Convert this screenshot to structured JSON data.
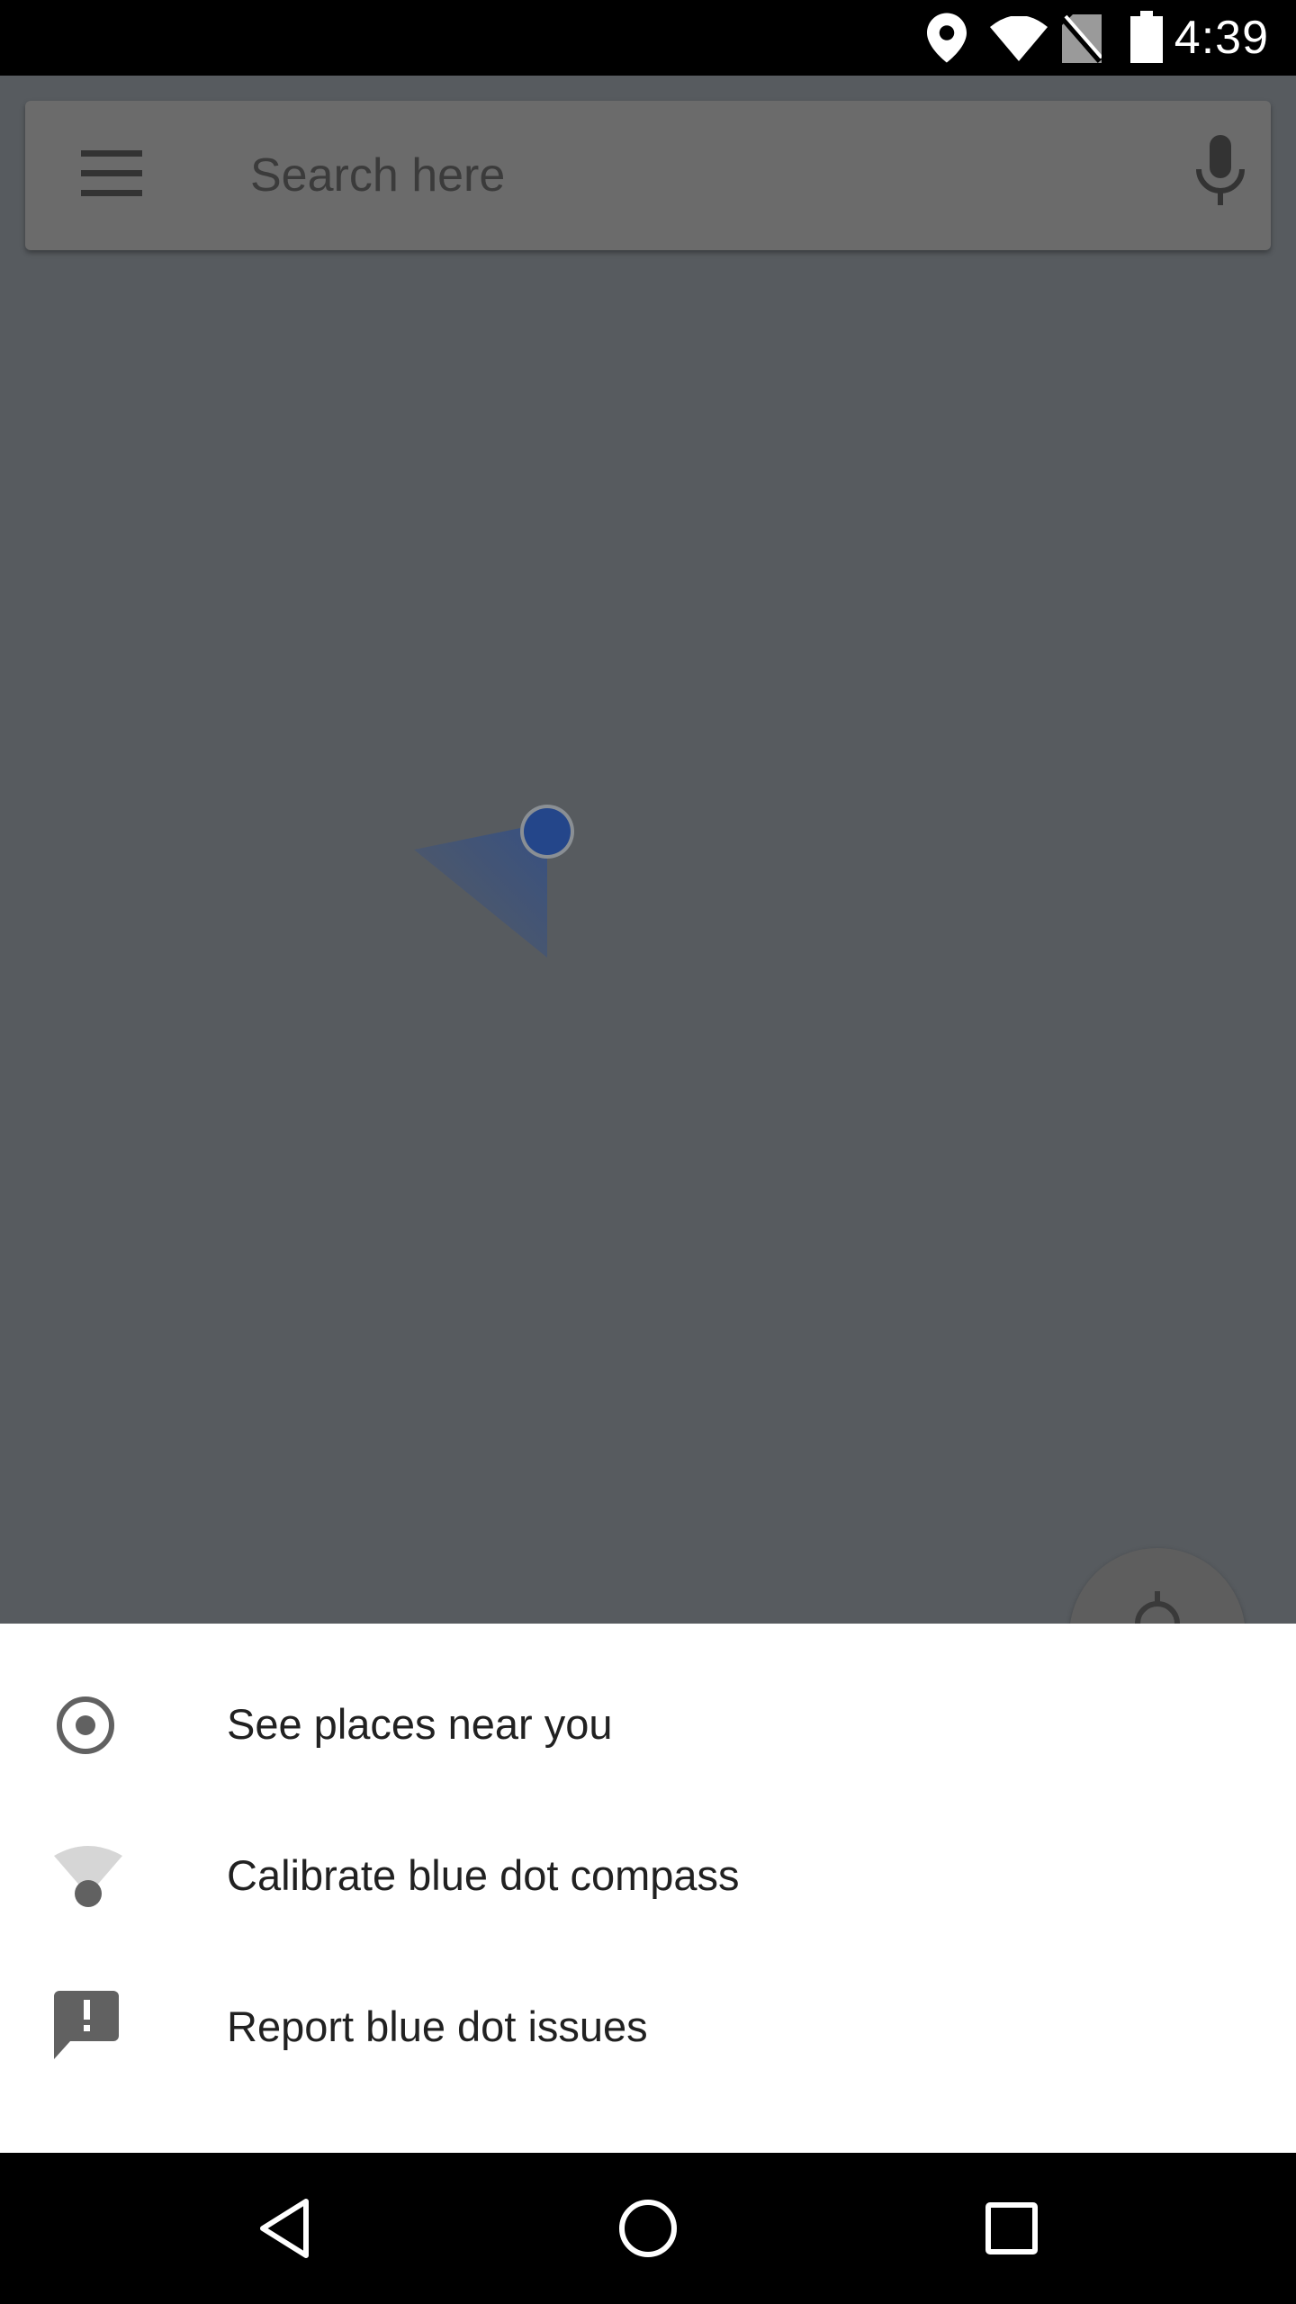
{
  "status_bar": {
    "time": "4:39",
    "icons": [
      "location-icon",
      "wifi-icon",
      "no-sim-icon",
      "battery-icon"
    ]
  },
  "search": {
    "placeholder": "Search here",
    "icons": [
      "menu-icon",
      "mic-icon"
    ]
  },
  "map": {
    "dot_color": "#24468a",
    "fab_icon": "my-location-icon"
  },
  "bottom_sheet": {
    "items": [
      {
        "label": "See places near you",
        "icon": "radio-target-icon"
      },
      {
        "label": "Calibrate blue dot compass",
        "icon": "compass-beam-icon"
      },
      {
        "label": "Report blue dot issues",
        "icon": "feedback-icon"
      }
    ]
  },
  "nav_bar": {
    "icons": [
      "back-icon",
      "home-icon",
      "recents-icon"
    ]
  },
  "colors": {
    "scrim": "#575b5f",
    "sheet_background": "#ffffff",
    "text_primary": "#212121",
    "icon_grey": "#616161"
  }
}
